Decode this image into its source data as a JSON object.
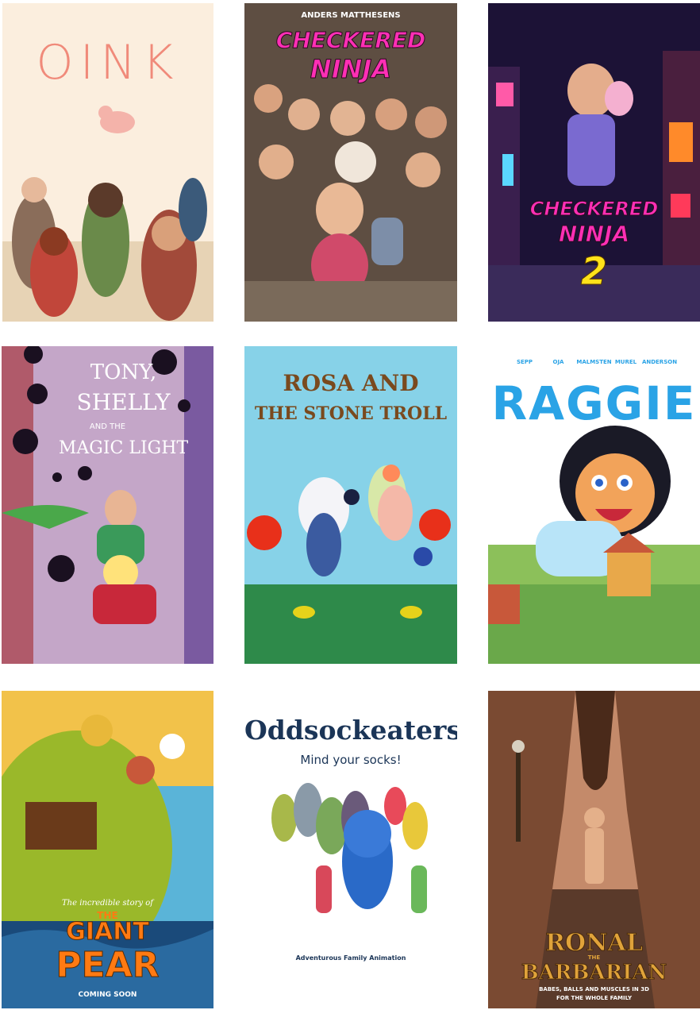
{
  "posters": [
    {
      "id": "oink",
      "title": "OINK",
      "credits": ""
    },
    {
      "id": "checkered-ninja",
      "kicker": "ANDERS MATTHESENS",
      "title_line1": "CHECKERED",
      "title_line2": "NINJA"
    },
    {
      "id": "checkered-ninja-2",
      "title_line1": "CHECKERED",
      "title_line2": "NINJA",
      "number": "2"
    },
    {
      "id": "tony-shelly",
      "title_line1": "TONY,",
      "title_line2": "SHELLY",
      "title_line3": "AND THE",
      "title_line4": "MAGIC LIGHT"
    },
    {
      "id": "rosa-stone-troll",
      "title_line1": "ROSA AND",
      "title_line2": "THE STONE TROLL"
    },
    {
      "id": "raggie",
      "cast": [
        "SEPP",
        "OJA",
        "MALMSTEN",
        "MUREL",
        "ANDERSON"
      ],
      "title": "RAGGIE"
    },
    {
      "id": "giant-pear",
      "small_title": "The incredible story of",
      "the": "THE",
      "title_line1": "GIANT",
      "title_line2": "PEAR",
      "tagline": "COMING SOON"
    },
    {
      "id": "oddsockeaters",
      "title": "Oddsockeaters",
      "subtitle": "Mind your socks!",
      "tagline": "Adventurous Family Animation"
    },
    {
      "id": "ronal",
      "title_line1": "RONAL",
      "the": "THE",
      "title_line2": "BARBARIAN",
      "tagline_line1": "BABES, BALLS AND MUSCLES IN 3D",
      "tagline_line2": "FOR THE WHOLE FAMILY"
    }
  ],
  "colors": {
    "oink_title": "#f08a7a",
    "ninja_pink": "#ff2fb5",
    "ninja_yellow": "#ffe21a",
    "rosa_brown": "#7a4a1e",
    "raggie_blue": "#2aa3e6",
    "pear_orange": "#ff7a12",
    "odd_navy": "#1b3557",
    "ronal_gold": "#e0a33a"
  }
}
